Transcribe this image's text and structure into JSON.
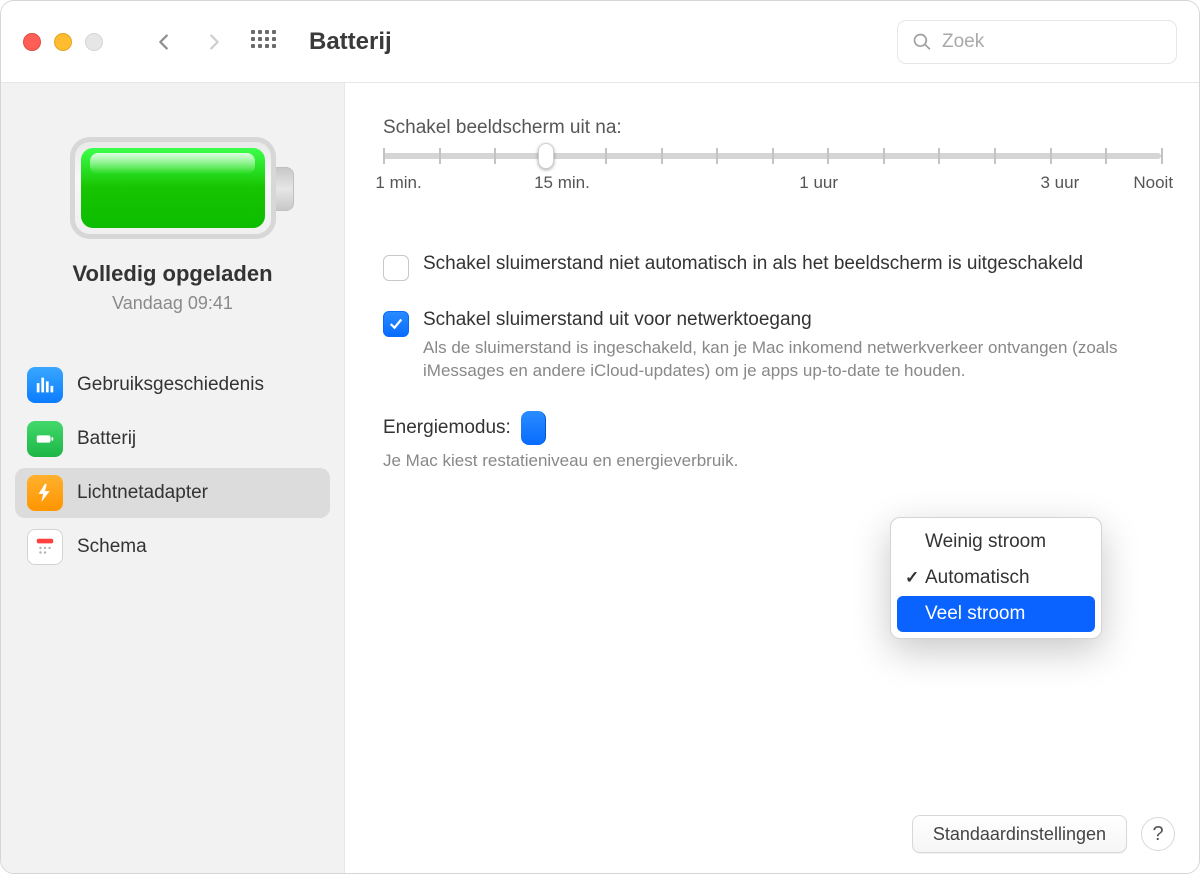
{
  "header": {
    "title": "Batterij",
    "search_placeholder": "Zoek"
  },
  "sidebar": {
    "status_title": "Volledig opgeladen",
    "status_subtitle": "Vandaag 09:41",
    "items": [
      {
        "label": "Gebruiksgeschiedenis"
      },
      {
        "label": "Batterij"
      },
      {
        "label": "Lichtnetadapter"
      },
      {
        "label": "Schema"
      }
    ],
    "selected_index": 2
  },
  "slider": {
    "label": "Schakel beeldscherm uit na:",
    "tick_labels": {
      "t0": "1 min.",
      "t22": "15 min.",
      "t56": "1 uur",
      "t87": "3 uur",
      "t100": "Nooit"
    },
    "thumb_pct": 21
  },
  "options": {
    "opt1": {
      "checked": false,
      "title": "Schakel sluimerstand niet automatisch in als het beeldscherm is uitgeschakeld"
    },
    "opt2": {
      "checked": true,
      "title": "Schakel sluimerstand uit voor netwerktoegang",
      "desc": "Als de sluimerstand is ingeschakeld, kan je Mac inkomend netwerkverkeer ontvangen (zoals iMessages en andere iCloud-updates) om je apps up-to-date te houden."
    }
  },
  "energy": {
    "label": "Energiemodus:",
    "desc_prefix": "Je Mac kiest ",
    "desc_suffix": "restatieniveau en energieverbruik.",
    "options": {
      "low": "Weinig stroom",
      "auto": "Automatisch",
      "high": "Veel stroom"
    },
    "current": "auto",
    "highlighted": "high"
  },
  "footer": {
    "defaults_label": "Standaardinstellingen",
    "help_label": "?"
  }
}
